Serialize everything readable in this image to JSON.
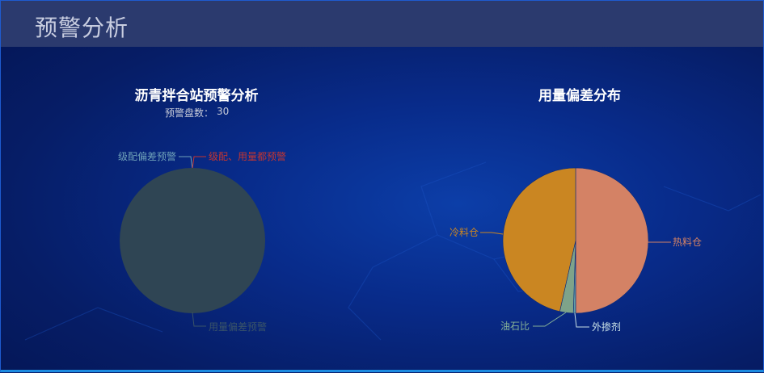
{
  "header": {
    "title": "预警分析"
  },
  "chart_data": [
    {
      "type": "pie",
      "title": "沥青拌合站预警分析",
      "subtitle_label": "预警盘数：",
      "subtitle_value": "30",
      "slices": [
        {
          "name": "级配偏差预警",
          "value": 0,
          "color": "#2f4554",
          "label_color": "#6ea0b8"
        },
        {
          "name": "级配、用量都预警",
          "value": 0,
          "color": "#c23531",
          "label_color": "#c23531"
        },
        {
          "name": "用量偏差预警",
          "value": 30,
          "color": "#2f4554",
          "label_color": "#3a5468"
        }
      ]
    },
    {
      "type": "pie",
      "title": "用量偏差分布",
      "slices": [
        {
          "name": "热料仓",
          "value": 50,
          "color": "#d48265",
          "label_color": "#d48265"
        },
        {
          "name": "外掺剂",
          "value": 0.5,
          "color": "#61a0a8",
          "label_color": "#c8e0e6"
        },
        {
          "name": "油石比",
          "value": 3,
          "color": "#7ea38a",
          "label_color": "#86b197"
        },
        {
          "name": "冷料仓",
          "value": 46.5,
          "color": "#ca8622",
          "label_color": "#ca8622"
        }
      ]
    }
  ]
}
